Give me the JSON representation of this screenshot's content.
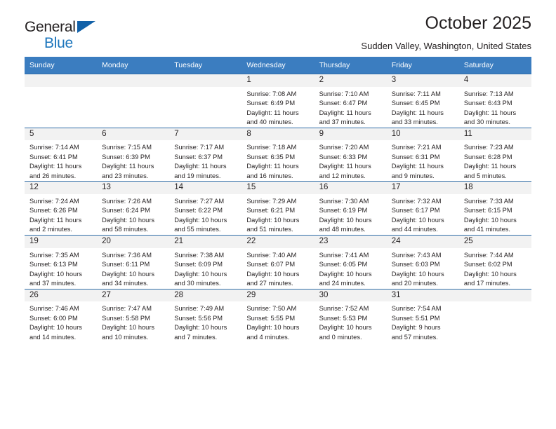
{
  "brand": {
    "name_part1": "General",
    "name_part2": "Blue",
    "accent_color": "#1c75bc",
    "triangle_color": "#1261a8"
  },
  "header": {
    "month_title": "October 2025",
    "location": "Sudden Valley, Washington, United States"
  },
  "calendar": {
    "header_bg": "#3b7dc0",
    "daynum_bg": "#f2f2f2",
    "border_color": "#2f6da8",
    "weekday_headers": [
      "Sunday",
      "Monday",
      "Tuesday",
      "Wednesday",
      "Thursday",
      "Friday",
      "Saturday"
    ],
    "weeks": [
      [
        {
          "day": "",
          "empty": true
        },
        {
          "day": "",
          "empty": true
        },
        {
          "day": "",
          "empty": true
        },
        {
          "day": "1",
          "sunrise": "Sunrise: 7:08 AM",
          "sunset": "Sunset: 6:49 PM",
          "daylight_l1": "Daylight: 11 hours",
          "daylight_l2": "and 40 minutes."
        },
        {
          "day": "2",
          "sunrise": "Sunrise: 7:10 AM",
          "sunset": "Sunset: 6:47 PM",
          "daylight_l1": "Daylight: 11 hours",
          "daylight_l2": "and 37 minutes."
        },
        {
          "day": "3",
          "sunrise": "Sunrise: 7:11 AM",
          "sunset": "Sunset: 6:45 PM",
          "daylight_l1": "Daylight: 11 hours",
          "daylight_l2": "and 33 minutes."
        },
        {
          "day": "4",
          "sunrise": "Sunrise: 7:13 AM",
          "sunset": "Sunset: 6:43 PM",
          "daylight_l1": "Daylight: 11 hours",
          "daylight_l2": "and 30 minutes."
        }
      ],
      [
        {
          "day": "5",
          "sunrise": "Sunrise: 7:14 AM",
          "sunset": "Sunset: 6:41 PM",
          "daylight_l1": "Daylight: 11 hours",
          "daylight_l2": "and 26 minutes."
        },
        {
          "day": "6",
          "sunrise": "Sunrise: 7:15 AM",
          "sunset": "Sunset: 6:39 PM",
          "daylight_l1": "Daylight: 11 hours",
          "daylight_l2": "and 23 minutes."
        },
        {
          "day": "7",
          "sunrise": "Sunrise: 7:17 AM",
          "sunset": "Sunset: 6:37 PM",
          "daylight_l1": "Daylight: 11 hours",
          "daylight_l2": "and 19 minutes."
        },
        {
          "day": "8",
          "sunrise": "Sunrise: 7:18 AM",
          "sunset": "Sunset: 6:35 PM",
          "daylight_l1": "Daylight: 11 hours",
          "daylight_l2": "and 16 minutes."
        },
        {
          "day": "9",
          "sunrise": "Sunrise: 7:20 AM",
          "sunset": "Sunset: 6:33 PM",
          "daylight_l1": "Daylight: 11 hours",
          "daylight_l2": "and 12 minutes."
        },
        {
          "day": "10",
          "sunrise": "Sunrise: 7:21 AM",
          "sunset": "Sunset: 6:31 PM",
          "daylight_l1": "Daylight: 11 hours",
          "daylight_l2": "and 9 minutes."
        },
        {
          "day": "11",
          "sunrise": "Sunrise: 7:23 AM",
          "sunset": "Sunset: 6:28 PM",
          "daylight_l1": "Daylight: 11 hours",
          "daylight_l2": "and 5 minutes."
        }
      ],
      [
        {
          "day": "12",
          "sunrise": "Sunrise: 7:24 AM",
          "sunset": "Sunset: 6:26 PM",
          "daylight_l1": "Daylight: 11 hours",
          "daylight_l2": "and 2 minutes."
        },
        {
          "day": "13",
          "sunrise": "Sunrise: 7:26 AM",
          "sunset": "Sunset: 6:24 PM",
          "daylight_l1": "Daylight: 10 hours",
          "daylight_l2": "and 58 minutes."
        },
        {
          "day": "14",
          "sunrise": "Sunrise: 7:27 AM",
          "sunset": "Sunset: 6:22 PM",
          "daylight_l1": "Daylight: 10 hours",
          "daylight_l2": "and 55 minutes."
        },
        {
          "day": "15",
          "sunrise": "Sunrise: 7:29 AM",
          "sunset": "Sunset: 6:21 PM",
          "daylight_l1": "Daylight: 10 hours",
          "daylight_l2": "and 51 minutes."
        },
        {
          "day": "16",
          "sunrise": "Sunrise: 7:30 AM",
          "sunset": "Sunset: 6:19 PM",
          "daylight_l1": "Daylight: 10 hours",
          "daylight_l2": "and 48 minutes."
        },
        {
          "day": "17",
          "sunrise": "Sunrise: 7:32 AM",
          "sunset": "Sunset: 6:17 PM",
          "daylight_l1": "Daylight: 10 hours",
          "daylight_l2": "and 44 minutes."
        },
        {
          "day": "18",
          "sunrise": "Sunrise: 7:33 AM",
          "sunset": "Sunset: 6:15 PM",
          "daylight_l1": "Daylight: 10 hours",
          "daylight_l2": "and 41 minutes."
        }
      ],
      [
        {
          "day": "19",
          "sunrise": "Sunrise: 7:35 AM",
          "sunset": "Sunset: 6:13 PM",
          "daylight_l1": "Daylight: 10 hours",
          "daylight_l2": "and 37 minutes."
        },
        {
          "day": "20",
          "sunrise": "Sunrise: 7:36 AM",
          "sunset": "Sunset: 6:11 PM",
          "daylight_l1": "Daylight: 10 hours",
          "daylight_l2": "and 34 minutes."
        },
        {
          "day": "21",
          "sunrise": "Sunrise: 7:38 AM",
          "sunset": "Sunset: 6:09 PM",
          "daylight_l1": "Daylight: 10 hours",
          "daylight_l2": "and 30 minutes."
        },
        {
          "day": "22",
          "sunrise": "Sunrise: 7:40 AM",
          "sunset": "Sunset: 6:07 PM",
          "daylight_l1": "Daylight: 10 hours",
          "daylight_l2": "and 27 minutes."
        },
        {
          "day": "23",
          "sunrise": "Sunrise: 7:41 AM",
          "sunset": "Sunset: 6:05 PM",
          "daylight_l1": "Daylight: 10 hours",
          "daylight_l2": "and 24 minutes."
        },
        {
          "day": "24",
          "sunrise": "Sunrise: 7:43 AM",
          "sunset": "Sunset: 6:03 PM",
          "daylight_l1": "Daylight: 10 hours",
          "daylight_l2": "and 20 minutes."
        },
        {
          "day": "25",
          "sunrise": "Sunrise: 7:44 AM",
          "sunset": "Sunset: 6:02 PM",
          "daylight_l1": "Daylight: 10 hours",
          "daylight_l2": "and 17 minutes."
        }
      ],
      [
        {
          "day": "26",
          "sunrise": "Sunrise: 7:46 AM",
          "sunset": "Sunset: 6:00 PM",
          "daylight_l1": "Daylight: 10 hours",
          "daylight_l2": "and 14 minutes."
        },
        {
          "day": "27",
          "sunrise": "Sunrise: 7:47 AM",
          "sunset": "Sunset: 5:58 PM",
          "daylight_l1": "Daylight: 10 hours",
          "daylight_l2": "and 10 minutes."
        },
        {
          "day": "28",
          "sunrise": "Sunrise: 7:49 AM",
          "sunset": "Sunset: 5:56 PM",
          "daylight_l1": "Daylight: 10 hours",
          "daylight_l2": "and 7 minutes."
        },
        {
          "day": "29",
          "sunrise": "Sunrise: 7:50 AM",
          "sunset": "Sunset: 5:55 PM",
          "daylight_l1": "Daylight: 10 hours",
          "daylight_l2": "and 4 minutes."
        },
        {
          "day": "30",
          "sunrise": "Sunrise: 7:52 AM",
          "sunset": "Sunset: 5:53 PM",
          "daylight_l1": "Daylight: 10 hours",
          "daylight_l2": "and 0 minutes."
        },
        {
          "day": "31",
          "sunrise": "Sunrise: 7:54 AM",
          "sunset": "Sunset: 5:51 PM",
          "daylight_l1": "Daylight: 9 hours",
          "daylight_l2": "and 57 minutes."
        },
        {
          "day": "",
          "empty": true
        }
      ]
    ]
  }
}
